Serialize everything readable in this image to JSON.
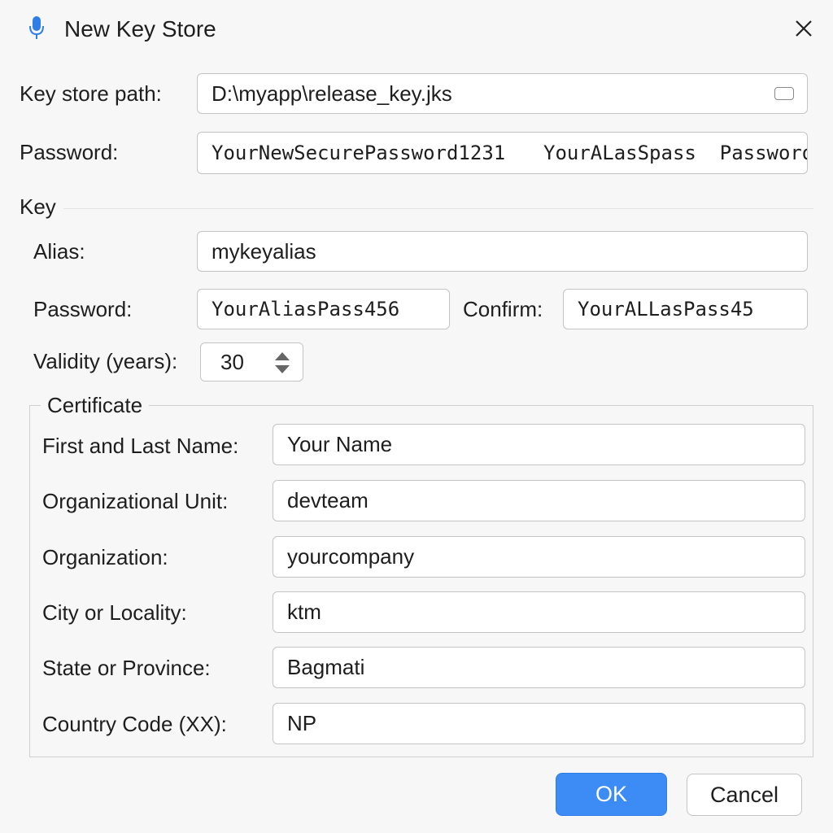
{
  "dialog": {
    "title": "New Key Store",
    "title_icon": "microphone-icon",
    "close_icon": "close-icon"
  },
  "keystore": {
    "path_label": "Key store path:",
    "path_value": "D:\\myapp\\release_key.jks",
    "browse_icon": "folder-icon",
    "password_label": "Password:",
    "password_value": "YourNewSecurePassword1231",
    "password_extra": "YourALasSpass  Password"
  },
  "key": {
    "section_label": "Key",
    "alias_label": "Alias:",
    "alias_value": "mykeyalias",
    "password_label": "Password:",
    "password_value": "YourAliasPass456",
    "confirm_label": "Confirm:",
    "confirm_value": "YourALLasPass45",
    "validity_label": "Validity (years):",
    "validity_value": "30"
  },
  "certificate": {
    "legend": "Certificate",
    "fields": [
      {
        "label": "First and Last Name:",
        "value": "Your Name"
      },
      {
        "label": "Organizational Unit:",
        "value": "devteam"
      },
      {
        "label": "Organization:",
        "value": "yourcompany"
      },
      {
        "label": "City or Locality:",
        "value": "ktm"
      },
      {
        "label": "State or Province:",
        "value": "Bagmati"
      },
      {
        "label": "Country Code (XX):",
        "value": "NP"
      }
    ]
  },
  "buttons": {
    "ok": "OK",
    "cancel": "Cancel"
  },
  "colors": {
    "accent": "#3d8cf5",
    "background": "#f7f7f7"
  }
}
